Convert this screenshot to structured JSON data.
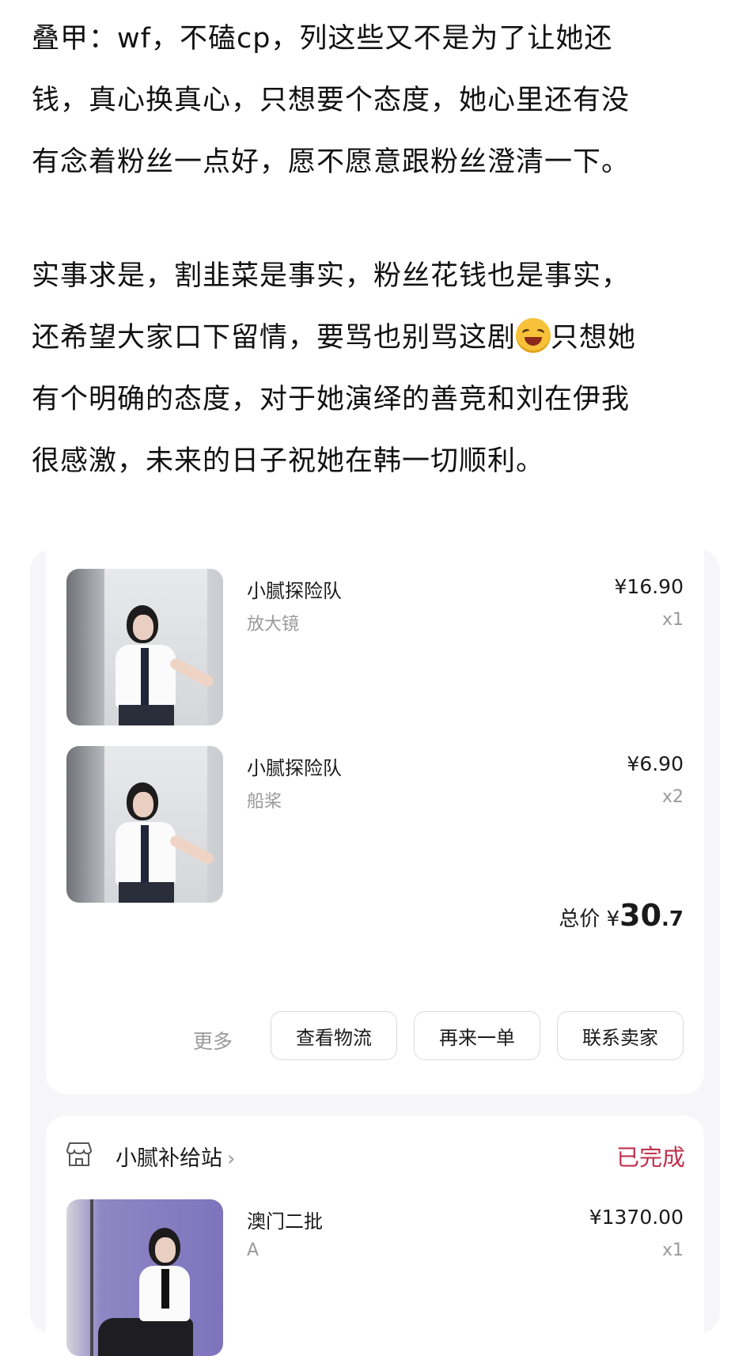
{
  "post": {
    "paragraph1": [
      "叠甲：wf，不磕cp，列这些又不是为了让她还",
      "钱，真心换真心，只想要个态度，她心里还有没",
      "有念着粉丝一点好，愿不愿意跟粉丝澄清一下。"
    ],
    "paragraph2": [
      "实事求是，割韭菜是事实，粉丝花钱也是事实，",
      "还希望大家口下留情，要骂也别骂这剧",
      "只想她",
      "有个明确的态度，对于她演绎的善竞和刘在伊我",
      "很感激，未来的日子祝她在韩一切顺利。"
    ],
    "emoji_icon": "rolling-on-floor-laughing-emoji"
  },
  "order1": {
    "items": [
      {
        "title": "小腻探险队",
        "spec": "放大镜",
        "price": "¥16.90",
        "qty": "x1"
      },
      {
        "title": "小腻探险队",
        "spec": "船桨",
        "price": "¥6.90",
        "qty": "x2"
      }
    ],
    "total_label": "总价",
    "currency": "¥",
    "total_int": "30",
    "total_dec": ".7",
    "more_label": "更多",
    "buttons": {
      "logistics": "查看物流",
      "reorder": "再来一单",
      "contact": "联系卖家"
    }
  },
  "order2": {
    "store_icon": "storefront-icon",
    "store_name": "小腻补给站",
    "chevron": "›",
    "status": "已完成",
    "status_color": "#c0314f",
    "items": [
      {
        "title": "澳门二批",
        "spec": "A",
        "price": "¥1370.00",
        "qty": "x1"
      }
    ]
  }
}
